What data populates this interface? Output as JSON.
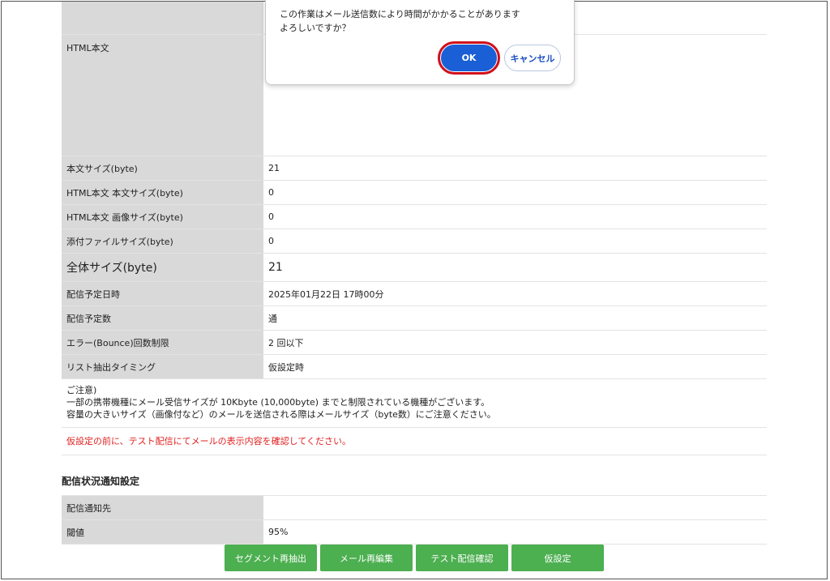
{
  "table": {
    "rows": [
      {
        "label": "",
        "value": ""
      },
      {
        "label": "HTML本文",
        "value": ""
      },
      {
        "label": "本文サイズ(byte)",
        "value": "21"
      },
      {
        "label": "HTML本文 本文サイズ(byte)",
        "value": "0"
      },
      {
        "label": "HTML本文 画像サイズ(byte)",
        "value": "0"
      },
      {
        "label": "添付ファイルサイズ(byte)",
        "value": "0"
      },
      {
        "label": "全体サイズ(byte)",
        "value": "21"
      },
      {
        "label": "配信予定日時",
        "value": "2025年01月22日 17時00分"
      },
      {
        "label": "配信予定数",
        "value": "通"
      },
      {
        "label": "エラー(Bounce)回数制限",
        "value": "2 回以下"
      },
      {
        "label": "リスト抽出タイミング",
        "value": "仮設定時"
      }
    ]
  },
  "notes": {
    "title": "ご注意)",
    "line1": "一部の携帯機種にメール受信サイズが 10Kbyte (10,000byte) までと制限されている機種がございます。",
    "line2": "容量の大きいサイズ（画像付など）のメールを送信される際はメールサイズ（byte数）にご注意ください。",
    "warning": "仮設定の前に、テスト配信にてメールの表示内容を確認してください。"
  },
  "notify": {
    "section_title": "配信状況通知設定",
    "rows": [
      {
        "label": "配信通知先",
        "value": ""
      },
      {
        "label": "閾値",
        "value": "95%"
      }
    ]
  },
  "buttons": {
    "segment": "セグメント再抽出",
    "edit": "メール再編集",
    "test": "テスト配信確認",
    "provisional": "仮設定"
  },
  "dialog": {
    "line1": "この作業はメール送信数により時間がかかることがあります",
    "line2": "よろしいですか？",
    "ok": "OK",
    "cancel": "キャンセル"
  },
  "colors": {
    "label_bg": "#d9d9d9",
    "button_green": "#4caf50",
    "ok_blue": "#1a5fd6",
    "highlight_red": "#d0101a",
    "warning_red": "#e02020"
  }
}
